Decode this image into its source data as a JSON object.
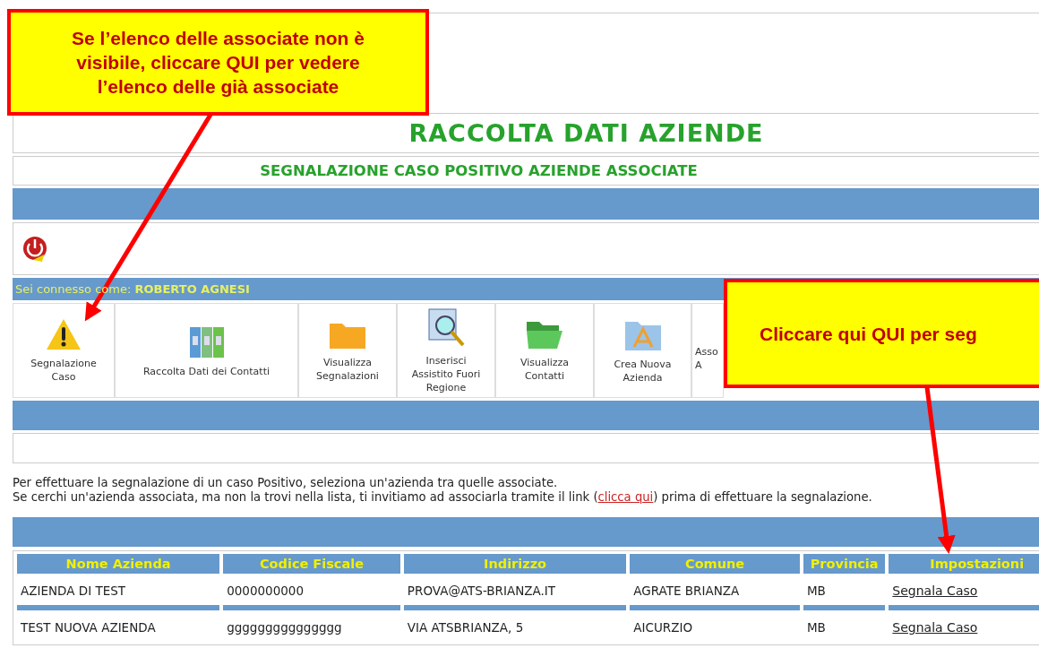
{
  "header": {
    "title": "RACCOLTA DATI AZIENDE",
    "subtitle": "SEGNALAZIONE CASO POSITIVO AZIENDE ASSOCIATE"
  },
  "user_bar": {
    "label": "Sei connesso come:",
    "user": "ROBERTO AGNESI"
  },
  "toolbar": [
    {
      "kind": "warning",
      "lines": [
        "Segnalazione",
        "Caso"
      ]
    },
    {
      "kind": "binders",
      "lines": [
        "Raccolta Dati dei Contatti"
      ]
    },
    {
      "kind": "folder",
      "lines": [
        "Visualizza",
        "Segnalazioni"
      ]
    },
    {
      "kind": "magnifier",
      "lines": [
        "Inserisci",
        "Assistito Fuori",
        "Regione"
      ]
    },
    {
      "kind": "open-folder",
      "lines": [
        "Visualizza",
        "Contatti"
      ]
    },
    {
      "kind": "app",
      "lines": [
        "Crea Nuova",
        "Azienda"
      ]
    },
    {
      "kind": "partial",
      "lines": [
        "Asso",
        "A"
      ]
    }
  ],
  "instructions": [
    "Per effettuare la segnalazione di un caso Positivo, seleziona un'azienda tra quelle associate.",
    "Se cerchi un'azienda associata, ma non la trovi nella lista, ti invitiamo ad associarla tramite il link (",
    "clicca qui",
    ") prima di effettuare la segnalazione."
  ],
  "table": {
    "columns": [
      "Nome Azienda",
      "Codice Fiscale",
      "Indirizzo",
      "Comune",
      "Provincia",
      "Impostazioni"
    ],
    "rows": [
      {
        "cells": [
          "AZIENDA DI TEST",
          "0000000000",
          "PROVA@ATS-BRIANZA.IT",
          "AGRATE BRIANZA",
          "MB"
        ],
        "action": "Segnala Caso"
      },
      {
        "cells": [
          "TEST NUOVA AZIENDA",
          "ggggggggggggggg",
          "VIA ATSBRIANZA, 5",
          "AICURZIO",
          "MB"
        ],
        "action": "Segnala Caso"
      }
    ]
  },
  "annotations": [
    {
      "kind": "top-left",
      "lines": [
        "Se l’elenco delle associate non è",
        "visibile, cliccare QUI per vedere",
        "l’elenco delle già associate"
      ]
    },
    {
      "kind": "right",
      "lines": [
        "Cliccare qui  QUI per seg"
      ]
    }
  ]
}
